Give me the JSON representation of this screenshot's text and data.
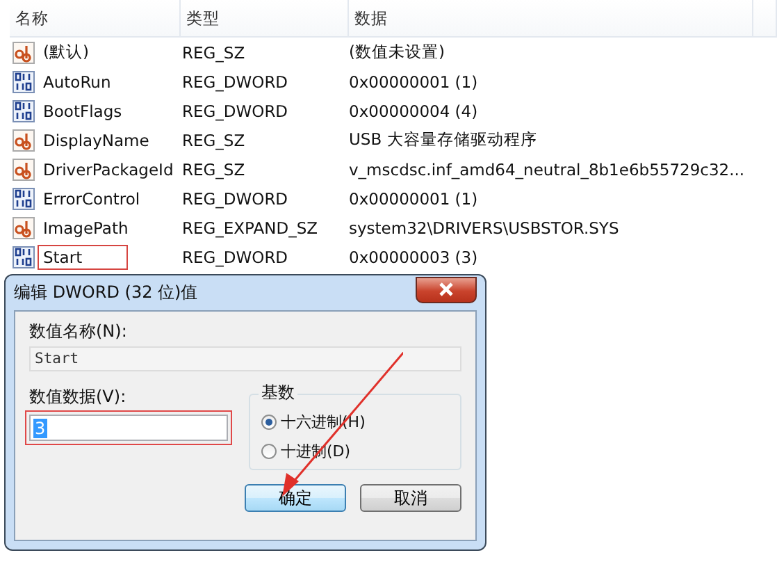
{
  "table": {
    "columns": [
      "名称",
      "类型",
      "数据"
    ],
    "rows": [
      {
        "kind": "string",
        "name": "(默认)",
        "type": "REG_SZ",
        "data": "(数值未设置)",
        "highlighted": false
      },
      {
        "kind": "binary",
        "name": "AutoRun",
        "type": "REG_DWORD",
        "data": "0x00000001 (1)",
        "highlighted": false
      },
      {
        "kind": "binary",
        "name": "BootFlags",
        "type": "REG_DWORD",
        "data": "0x00000004 (4)",
        "highlighted": false
      },
      {
        "kind": "string",
        "name": "DisplayName",
        "type": "REG_SZ",
        "data": "USB 大容量存储驱动程序",
        "highlighted": false
      },
      {
        "kind": "string",
        "name": "DriverPackageId",
        "type": "REG_SZ",
        "data": "v_mscdsc.inf_amd64_neutral_8b1e6b55729c32...",
        "highlighted": false
      },
      {
        "kind": "binary",
        "name": "ErrorControl",
        "type": "REG_DWORD",
        "data": "0x00000001 (1)",
        "highlighted": false
      },
      {
        "kind": "string",
        "name": "ImagePath",
        "type": "REG_EXPAND_SZ",
        "data": "system32\\DRIVERS\\USBSTOR.SYS",
        "highlighted": false
      },
      {
        "kind": "binary",
        "name": "Start",
        "type": "REG_DWORD",
        "data": "0x00000003 (3)",
        "highlighted": true
      }
    ]
  },
  "dialog": {
    "title": "编辑 DWORD (32 位)值",
    "name_label": "数值名称(N):",
    "name_value": "Start",
    "data_label": "数值数据(V):",
    "data_value": "3",
    "data_highlighted": true,
    "base_label": "基数",
    "radios": [
      {
        "label": "十六进制(H)",
        "selected": true
      },
      {
        "label": "十进制(D)",
        "selected": false
      }
    ],
    "buttons": [
      {
        "label": "确定",
        "default": true
      },
      {
        "label": "取消",
        "default": false
      }
    ]
  }
}
